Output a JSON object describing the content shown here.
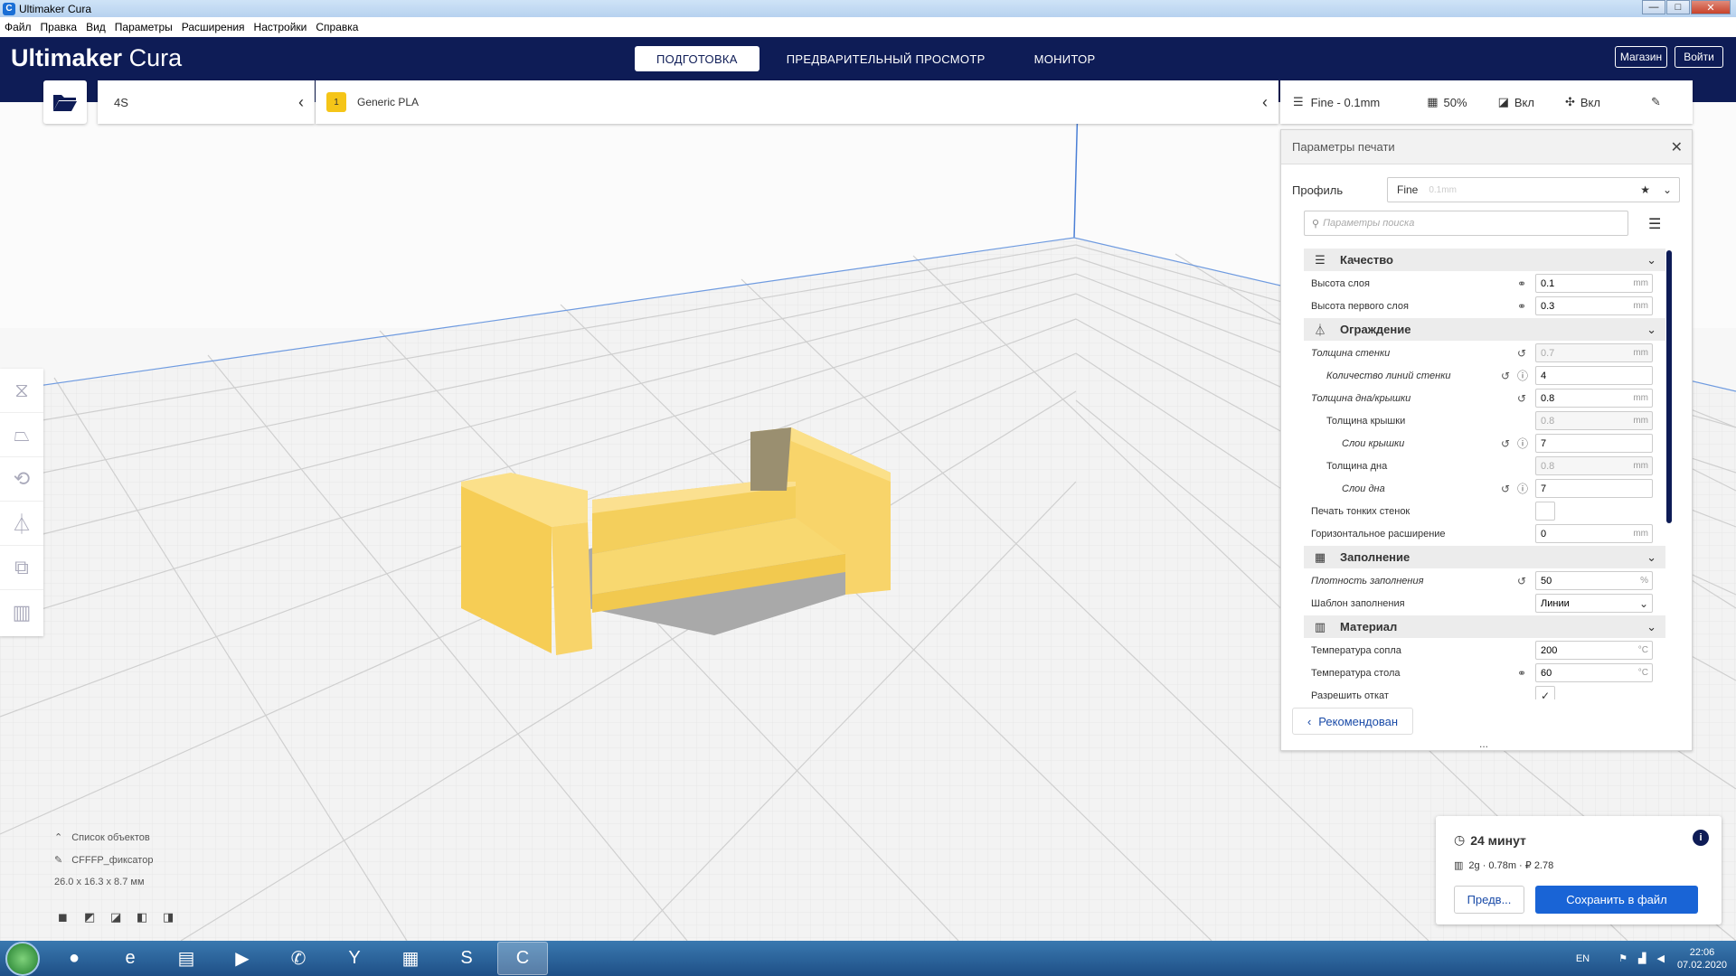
{
  "window": {
    "title": "Ultimaker Cura",
    "min": "—",
    "max": "□",
    "close": "✕"
  },
  "menu": [
    "Файл",
    "Правка",
    "Вид",
    "Параметры",
    "Расширения",
    "Настройки",
    "Справка"
  ],
  "header": {
    "logo_bold": "Ultimaker",
    "logo_light": " Cura",
    "tabs": [
      "ПОДГОТОВКА",
      "ПРЕДВАРИТЕЛЬНЫЙ ПРОСМОТР",
      "МОНИТОР"
    ],
    "active_tab": "ПОДГОТОВКА",
    "marketplace": "Магазин",
    "signin": "Войти"
  },
  "printer": {
    "name": "4S"
  },
  "material": {
    "extruder": "1",
    "name": "Generic PLA"
  },
  "settings_bar": {
    "quality": "Fine - 0.1mm",
    "infill": "50%",
    "support": "Вкл",
    "adhesion": "Вкл"
  },
  "panel": {
    "title": "Параметры печати",
    "profile_label": "Профиль",
    "profile_name": "Fine",
    "profile_detail": "0.1mm",
    "search_placeholder": "Параметры поиска",
    "categories": [
      {
        "icon": "quality-icon",
        "label": "Качество",
        "rows": [
          {
            "label": "Высота слоя",
            "value": "0.1",
            "unit": "mm",
            "link": true
          },
          {
            "label": "Высота первого слоя",
            "value": "0.3",
            "unit": "mm",
            "link": true
          }
        ]
      },
      {
        "icon": "shell-icon",
        "label": "Ограждение",
        "rows": [
          {
            "label": "Толщина стенки",
            "value": "0.7",
            "unit": "mm",
            "reset": true,
            "disabled": true,
            "italic": true
          },
          {
            "label": "Количество линий стенки",
            "value": "4",
            "indent": 1,
            "reset": true,
            "info": true,
            "italic": true
          },
          {
            "label": "Толщина дна/крышки",
            "value": "0.8",
            "unit": "mm",
            "reset": true,
            "italic": true
          },
          {
            "label": "Толщина крышки",
            "value": "0.8",
            "unit": "mm",
            "indent": 1,
            "disabled": true
          },
          {
            "label": "Слои крышки",
            "value": "7",
            "indent": 2,
            "reset": true,
            "info": true,
            "italic": true
          },
          {
            "label": "Толщина дна",
            "value": "0.8",
            "unit": "mm",
            "indent": 1,
            "disabled": true
          },
          {
            "label": "Слои дна",
            "value": "7",
            "indent": 2,
            "reset": true,
            "info": true,
            "italic": true
          },
          {
            "label": "Печать тонких стенок",
            "checkbox": true,
            "checked": false
          },
          {
            "label": "Горизонтальное расширение",
            "value": "0",
            "unit": "mm"
          }
        ]
      },
      {
        "icon": "infill-icon",
        "label": "Заполнение",
        "rows": [
          {
            "label": "Плотность заполнения",
            "value": "50",
            "unit": "%",
            "reset": true,
            "italic": true
          },
          {
            "label": "Шаблон заполнения",
            "value": "Линии",
            "select": true
          }
        ]
      },
      {
        "icon": "material-icon",
        "label": "Материал",
        "rows": [
          {
            "label": "Температура сопла",
            "value": "200",
            "unit": "°C"
          },
          {
            "label": "Температура стола",
            "value": "60",
            "unit": "°C",
            "link": true
          },
          {
            "label": "Разрешить откат",
            "checkbox": true,
            "checked": true
          }
        ]
      }
    ],
    "recommended": "Рекомендован",
    "more": "..."
  },
  "object_list": {
    "toggle_label": "Список объектов",
    "object_name": "CFFFP_фиксатор",
    "dimensions": "26.0 x 16.3 x 8.7 мм"
  },
  "print_info": {
    "time": "24 минут",
    "material": "2g · 0.78m · ₽ 2.78",
    "preview": "Предв...",
    "save": "Сохранить в файл"
  },
  "taskbar": {
    "lang": "EN",
    "time": "22:06",
    "date": "07.02.2020"
  },
  "colors": {
    "header": "#0e1c56",
    "model": "#f8d76a",
    "accent": "#1964d6",
    "grid": "#cfcfcf"
  }
}
